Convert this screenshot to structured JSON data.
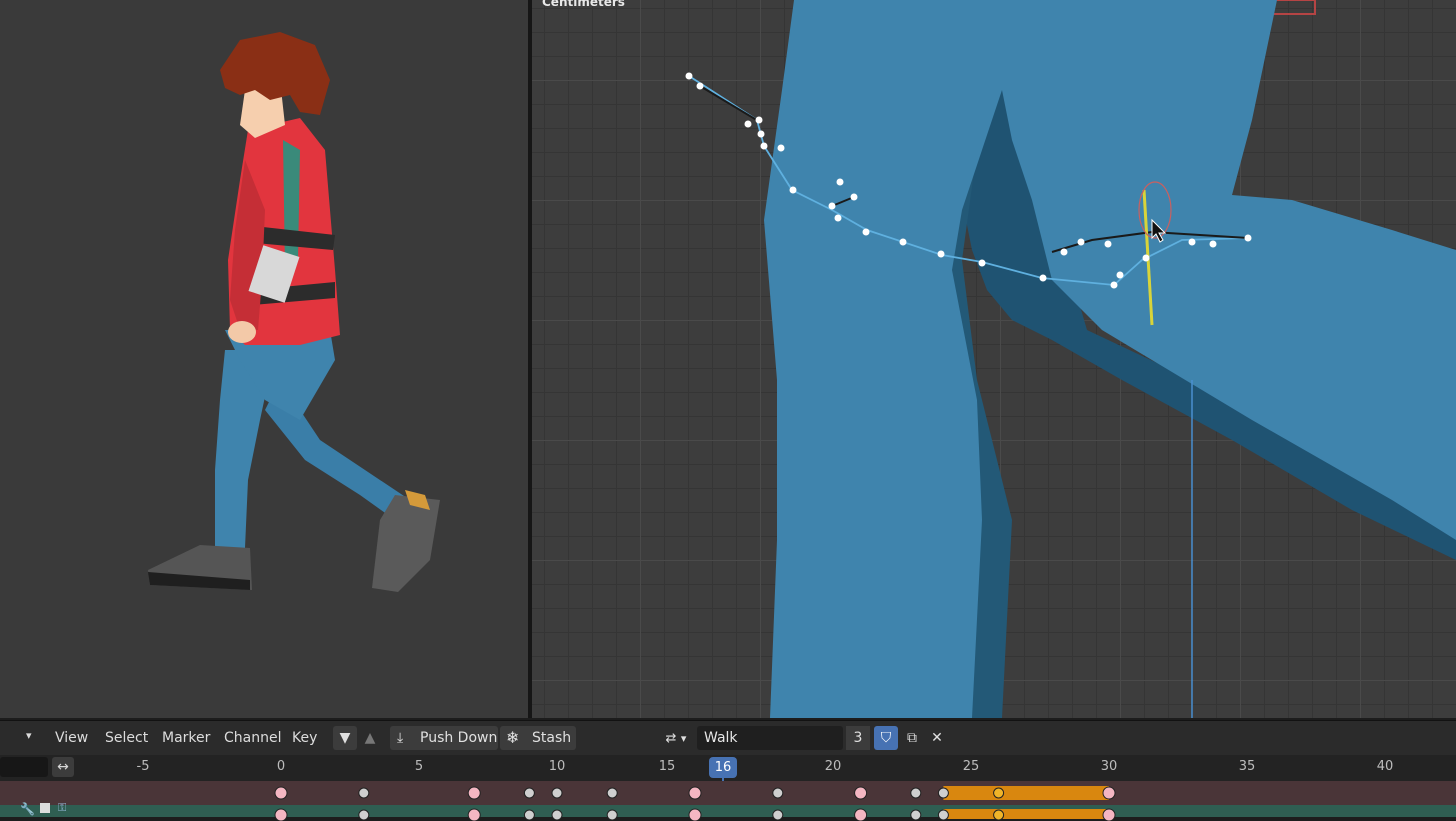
{
  "viewport_right": {
    "units_label": "Centimeters"
  },
  "header": {
    "menu": [
      "View",
      "Select",
      "Marker",
      "Channel",
      "Key"
    ],
    "push_down_label": "Push Down",
    "stash_label": "Stash",
    "action_name": "Walk",
    "users_count": "3"
  },
  "timeline": {
    "ruler_labels": [
      "-5",
      "0",
      "5",
      "10",
      "15",
      "20",
      "25",
      "30",
      "35",
      "40"
    ],
    "current_frame": "16",
    "keyframes": [
      0,
      3,
      7,
      9,
      10,
      12,
      15,
      18,
      21,
      23,
      24,
      26,
      30
    ],
    "range_highlight": [
      24,
      30
    ],
    "selected_keyframes": [
      26
    ]
  },
  "colors": {
    "accent": "#4772b3",
    "keyframe": "#f4b6c2",
    "keyframe_selected": "#f0b429",
    "range": "#d9870f",
    "curve": "#5fb0df",
    "character_jacket": "#e2353e",
    "character_jeans": "#3f84ad"
  }
}
